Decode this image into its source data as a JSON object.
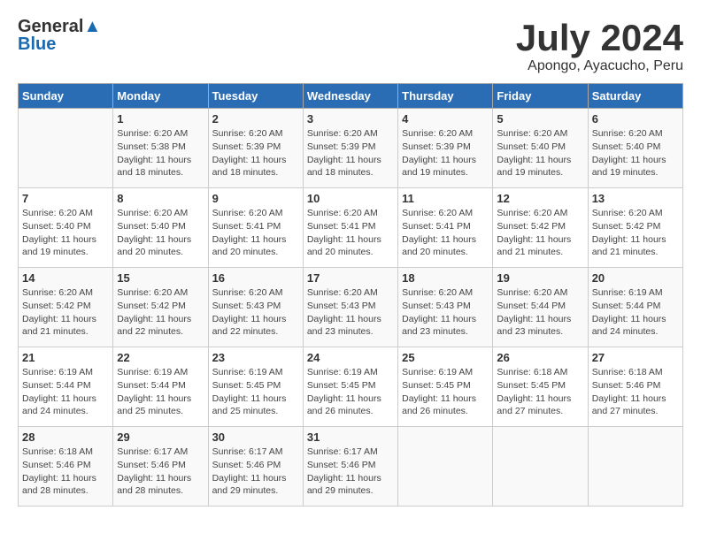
{
  "logo": {
    "general": "General",
    "blue": "Blue"
  },
  "title": {
    "month_year": "July 2024",
    "location": "Apongo, Ayacucho, Peru"
  },
  "days_of_week": [
    "Sunday",
    "Monday",
    "Tuesday",
    "Wednesday",
    "Thursday",
    "Friday",
    "Saturday"
  ],
  "weeks": [
    [
      {
        "day": "",
        "info": ""
      },
      {
        "day": "1",
        "info": "Sunrise: 6:20 AM\nSunset: 5:38 PM\nDaylight: 11 hours\nand 18 minutes."
      },
      {
        "day": "2",
        "info": "Sunrise: 6:20 AM\nSunset: 5:39 PM\nDaylight: 11 hours\nand 18 minutes."
      },
      {
        "day": "3",
        "info": "Sunrise: 6:20 AM\nSunset: 5:39 PM\nDaylight: 11 hours\nand 18 minutes."
      },
      {
        "day": "4",
        "info": "Sunrise: 6:20 AM\nSunset: 5:39 PM\nDaylight: 11 hours\nand 19 minutes."
      },
      {
        "day": "5",
        "info": "Sunrise: 6:20 AM\nSunset: 5:40 PM\nDaylight: 11 hours\nand 19 minutes."
      },
      {
        "day": "6",
        "info": "Sunrise: 6:20 AM\nSunset: 5:40 PM\nDaylight: 11 hours\nand 19 minutes."
      }
    ],
    [
      {
        "day": "7",
        "info": "Sunrise: 6:20 AM\nSunset: 5:40 PM\nDaylight: 11 hours\nand 19 minutes."
      },
      {
        "day": "8",
        "info": "Sunrise: 6:20 AM\nSunset: 5:40 PM\nDaylight: 11 hours\nand 20 minutes."
      },
      {
        "day": "9",
        "info": "Sunrise: 6:20 AM\nSunset: 5:41 PM\nDaylight: 11 hours\nand 20 minutes."
      },
      {
        "day": "10",
        "info": "Sunrise: 6:20 AM\nSunset: 5:41 PM\nDaylight: 11 hours\nand 20 minutes."
      },
      {
        "day": "11",
        "info": "Sunrise: 6:20 AM\nSunset: 5:41 PM\nDaylight: 11 hours\nand 20 minutes."
      },
      {
        "day": "12",
        "info": "Sunrise: 6:20 AM\nSunset: 5:42 PM\nDaylight: 11 hours\nand 21 minutes."
      },
      {
        "day": "13",
        "info": "Sunrise: 6:20 AM\nSunset: 5:42 PM\nDaylight: 11 hours\nand 21 minutes."
      }
    ],
    [
      {
        "day": "14",
        "info": "Sunrise: 6:20 AM\nSunset: 5:42 PM\nDaylight: 11 hours\nand 21 minutes."
      },
      {
        "day": "15",
        "info": "Sunrise: 6:20 AM\nSunset: 5:42 PM\nDaylight: 11 hours\nand 22 minutes."
      },
      {
        "day": "16",
        "info": "Sunrise: 6:20 AM\nSunset: 5:43 PM\nDaylight: 11 hours\nand 22 minutes."
      },
      {
        "day": "17",
        "info": "Sunrise: 6:20 AM\nSunset: 5:43 PM\nDaylight: 11 hours\nand 23 minutes."
      },
      {
        "day": "18",
        "info": "Sunrise: 6:20 AM\nSunset: 5:43 PM\nDaylight: 11 hours\nand 23 minutes."
      },
      {
        "day": "19",
        "info": "Sunrise: 6:20 AM\nSunset: 5:44 PM\nDaylight: 11 hours\nand 23 minutes."
      },
      {
        "day": "20",
        "info": "Sunrise: 6:19 AM\nSunset: 5:44 PM\nDaylight: 11 hours\nand 24 minutes."
      }
    ],
    [
      {
        "day": "21",
        "info": "Sunrise: 6:19 AM\nSunset: 5:44 PM\nDaylight: 11 hours\nand 24 minutes."
      },
      {
        "day": "22",
        "info": "Sunrise: 6:19 AM\nSunset: 5:44 PM\nDaylight: 11 hours\nand 25 minutes."
      },
      {
        "day": "23",
        "info": "Sunrise: 6:19 AM\nSunset: 5:45 PM\nDaylight: 11 hours\nand 25 minutes."
      },
      {
        "day": "24",
        "info": "Sunrise: 6:19 AM\nSunset: 5:45 PM\nDaylight: 11 hours\nand 26 minutes."
      },
      {
        "day": "25",
        "info": "Sunrise: 6:19 AM\nSunset: 5:45 PM\nDaylight: 11 hours\nand 26 minutes."
      },
      {
        "day": "26",
        "info": "Sunrise: 6:18 AM\nSunset: 5:45 PM\nDaylight: 11 hours\nand 27 minutes."
      },
      {
        "day": "27",
        "info": "Sunrise: 6:18 AM\nSunset: 5:46 PM\nDaylight: 11 hours\nand 27 minutes."
      }
    ],
    [
      {
        "day": "28",
        "info": "Sunrise: 6:18 AM\nSunset: 5:46 PM\nDaylight: 11 hours\nand 28 minutes."
      },
      {
        "day": "29",
        "info": "Sunrise: 6:17 AM\nSunset: 5:46 PM\nDaylight: 11 hours\nand 28 minutes."
      },
      {
        "day": "30",
        "info": "Sunrise: 6:17 AM\nSunset: 5:46 PM\nDaylight: 11 hours\nand 29 minutes."
      },
      {
        "day": "31",
        "info": "Sunrise: 6:17 AM\nSunset: 5:46 PM\nDaylight: 11 hours\nand 29 minutes."
      },
      {
        "day": "",
        "info": ""
      },
      {
        "day": "",
        "info": ""
      },
      {
        "day": "",
        "info": ""
      }
    ]
  ]
}
